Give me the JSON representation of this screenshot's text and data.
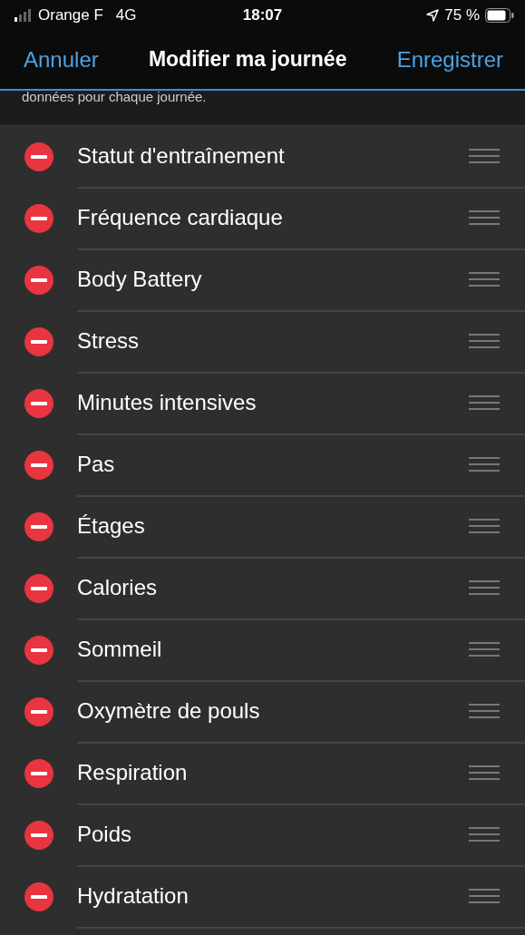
{
  "status_bar": {
    "carrier": "Orange F",
    "network": "4G",
    "time": "18:07",
    "battery": "75 %"
  },
  "nav": {
    "cancel": "Annuler",
    "title": "Modifier ma journée",
    "save": "Enregistrer"
  },
  "intro": "données pour chaque journée.",
  "items": [
    {
      "label": "Statut d'entraînement"
    },
    {
      "label": "Fréquence cardiaque"
    },
    {
      "label": "Body Battery"
    },
    {
      "label": "Stress"
    },
    {
      "label": "Minutes intensives"
    },
    {
      "label": "Pas"
    },
    {
      "label": "Étages"
    },
    {
      "label": "Calories"
    },
    {
      "label": "Sommeil"
    },
    {
      "label": "Oxymètre de pouls"
    },
    {
      "label": "Respiration"
    },
    {
      "label": "Poids"
    },
    {
      "label": "Hydratation"
    }
  ]
}
